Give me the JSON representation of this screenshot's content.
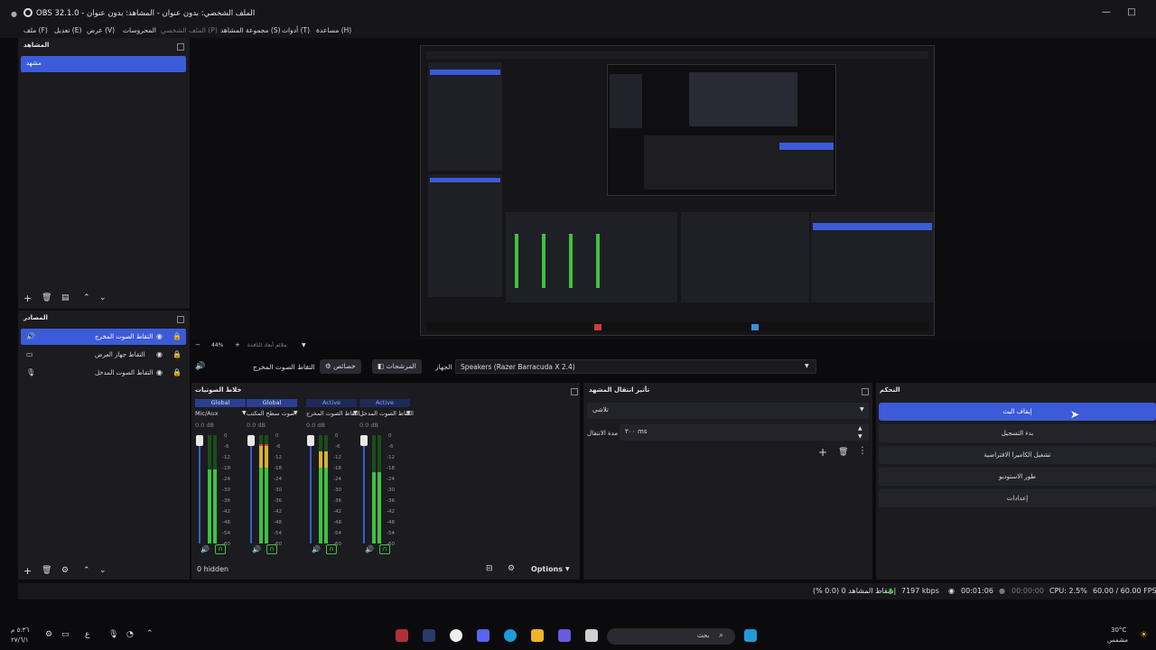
{
  "window": {
    "title": "OBS 32.1.0 - الملف الشخصي: بدون عنوان - المشاهد: بدون عنوان"
  },
  "menu": [
    {
      "label": "ملف (F)",
      "disabled": false
    },
    {
      "label": "تعديل (E)",
      "disabled": false
    },
    {
      "label": "عرض (V)",
      "disabled": false
    },
    {
      "label": "المحروسات",
      "disabled": false
    },
    {
      "label": "الملف الشخصي (P)",
      "disabled": true
    },
    {
      "label": "مجموعة المشاهد (S)",
      "disabled": false
    },
    {
      "label": "أدوات (T)",
      "disabled": false
    },
    {
      "label": "مساعدة (H)",
      "disabled": false
    }
  ],
  "scenes": {
    "header": "المشاهد",
    "items": [
      "مشهد"
    ]
  },
  "sources": {
    "header": "المصادر",
    "items": [
      {
        "label": "التقاط الصوت المخرج",
        "icon": "speaker-icon",
        "active": true
      },
      {
        "label": "التقاط جهاز العرض",
        "icon": "monitor-icon",
        "active": false
      },
      {
        "label": "التقاط الصوت المدخل",
        "icon": "microphone-icon",
        "active": false
      }
    ]
  },
  "preview": {
    "zoom": "44%",
    "size_label": "ملائم أبعاد النافذة"
  },
  "source_toolbar": {
    "source_name": "التقاط الصوت المخرج",
    "properties": "خصائص",
    "filters": "المرشحات",
    "device_label": "الجهاز",
    "device_value": "Speakers (Razer Barracuda X 2.4)"
  },
  "mixer": {
    "header": "خلاط الصوتيات",
    "channels": [
      {
        "tag": "Global",
        "tag_active": false,
        "name": "Mic/Aux",
        "db": "0.0 dB",
        "level": 0.68
      },
      {
        "tag": "Global",
        "tag_active": false,
        "name": "صوت سطح المكتب",
        "db": "0.0 dB",
        "level": 0.92
      },
      {
        "tag": "Active",
        "tag_active": true,
        "name": "التقاط الصوت المخرج",
        "db": "0.0 dB",
        "level": 0.85
      },
      {
        "tag": "Active",
        "tag_active": true,
        "name": "التقاط الصوت المدخل",
        "db": "0.0 dB",
        "level": 0.66
      }
    ],
    "scale": [
      "0",
      "-6",
      "-12",
      "-18",
      "-24",
      "-30",
      "-36",
      "-42",
      "-48",
      "-54",
      "-60"
    ],
    "hidden": "0 hidden",
    "options": "Options"
  },
  "transitions": {
    "header": "تأثير انتقال المشهد",
    "type": "تلاشي",
    "duration_label": "مدة الانتقال",
    "duration_value": "٣٠٠",
    "duration_unit": "ms"
  },
  "controls": {
    "header": "التحكم",
    "buttons": [
      "إيقاف البث",
      "بدء التسجيل",
      "تشغيل الكاميرا الافتراضية",
      "طور الاستوديو",
      "إعدادات"
    ]
  },
  "status": {
    "dropped": "إسقاط المشاهد 0 (0.0 %)",
    "bitrate": "7197 kbps",
    "stream_time": "00:01:06",
    "rec_time": "00:00:00",
    "cpu": "CPU: 2.5%",
    "fps": "60.00 / 60.00 FPS"
  },
  "taskbar": {
    "time": "٥:٣٦ م",
    "date": "٢٧/٦/١",
    "weather_temp": "30°C",
    "weather_desc": "مشمس",
    "search_placeholder": "بحث"
  },
  "colors": {
    "accent": "#3c5bd8",
    "panel": "#1b1b20",
    "bg": "#0b0b0d",
    "meter_green": "#3ec23e",
    "meter_yellow": "#d8b22e",
    "meter_red": "#d23a3a"
  }
}
